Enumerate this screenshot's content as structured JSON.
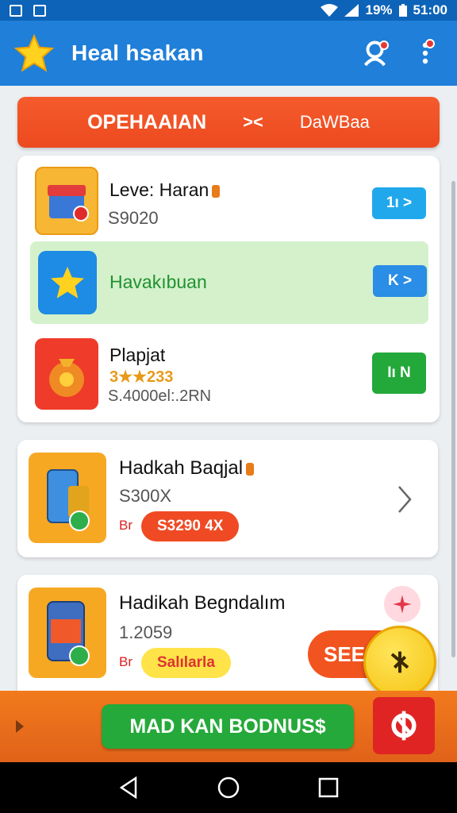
{
  "status_bar": {
    "battery": "19%",
    "time": "51:00"
  },
  "app_bar": {
    "title": "Heal hsakan",
    "icons": [
      "star-icon",
      "profile-search-icon",
      "more-vert-icon"
    ]
  },
  "banner": {
    "left": "OPEHAAIAN",
    "mid": "><",
    "right": "DaWBaa"
  },
  "rows": [
    {
      "title": "Leve: Haran",
      "sub": "S9020",
      "button": "1ı >",
      "button_color": "#21a8ec"
    },
    {
      "title": "Havakıbuan",
      "button": "K >",
      "button_color": "#2a8de6"
    },
    {
      "title": "Plapjat",
      "stars": "3★★233",
      "sub": "S.4000el:.2RN",
      "button": "Iı N",
      "button_color": "#23a83a"
    }
  ],
  "cards": [
    {
      "title": "Hadkah Baqjal",
      "price": "S300X",
      "currency": "Br",
      "tag": "S3290 4X",
      "tag_color": "#ef4a24"
    },
    {
      "title": "Hadikah Begndalım",
      "price": "1.2059",
      "currency": "Br",
      "tag": "Salılarla",
      "tag_color": "#ffe348"
    }
  ],
  "see_button": "SEE",
  "bonus_button": "MAD KAN BODNUS$",
  "accent": "#1f7fd9"
}
